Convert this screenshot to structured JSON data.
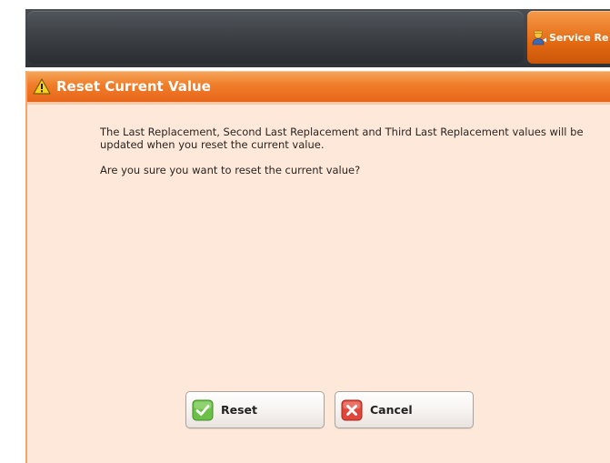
{
  "topbar": {
    "service_button_label": "Service Re",
    "service_icon": "service-rep-icon"
  },
  "dialog": {
    "title": "Reset Current Value",
    "title_icon": "warning-icon",
    "message_line1": "The Last Replacement, Second Last Replacement and Third Last Replacement values will be updated when you reset the current value.",
    "message_line2": "Are you sure you want to reset the current value?"
  },
  "buttons": {
    "reset_label": "Reset",
    "reset_icon": "check-icon",
    "cancel_label": "Cancel",
    "cancel_icon": "x-icon"
  },
  "colors": {
    "accent": "#e8661a",
    "dialog_bg": "#fde8da",
    "topbar": "#3a3e43",
    "reset_icon_color": "#5bb53a",
    "cancel_icon_color": "#d8402c"
  }
}
